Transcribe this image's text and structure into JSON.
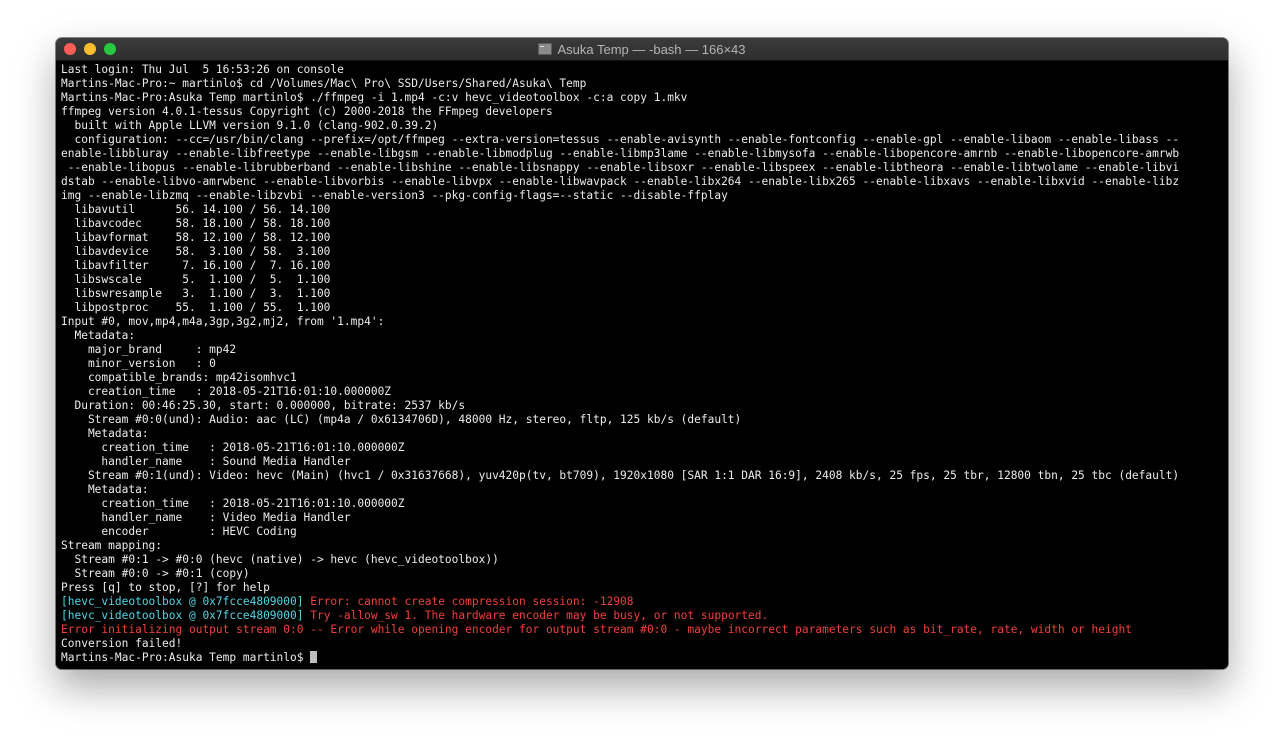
{
  "window": {
    "title": "Asuka Temp — -bash — 166×43"
  },
  "terminal": {
    "lines": [
      "Last login: Thu Jul  5 16:53:26 on console",
      "Martins-Mac-Pro:~ martinlo$ cd /Volumes/Mac\\ Pro\\ SSD/Users/Shared/Asuka\\ Temp",
      "Martins-Mac-Pro:Asuka Temp martinlo$ ./ffmpeg -i 1.mp4 -c:v hevc_videotoolbox -c:a copy 1.mkv",
      "ffmpeg version 4.0.1-tessus Copyright (c) 2000-2018 the FFmpeg developers",
      "  built with Apple LLVM version 9.1.0 (clang-902.0.39.2)",
      "  configuration: --cc=/usr/bin/clang --prefix=/opt/ffmpeg --extra-version=tessus --enable-avisynth --enable-fontconfig --enable-gpl --enable-libaom --enable-libass --",
      "enable-libbluray --enable-libfreetype --enable-libgsm --enable-libmodplug --enable-libmp3lame --enable-libmysofa --enable-libopencore-amrnb --enable-libopencore-amrwb",
      " --enable-libopus --enable-librubberband --enable-libshine --enable-libsnappy --enable-libsoxr --enable-libspeex --enable-libtheora --enable-libtwolame --enable-libvi",
      "dstab --enable-libvo-amrwbenc --enable-libvorbis --enable-libvpx --enable-libwavpack --enable-libx264 --enable-libx265 --enable-libxavs --enable-libxvid --enable-libz",
      "img --enable-libzmq --enable-libzvbi --enable-version3 --pkg-config-flags=--static --disable-ffplay",
      "  libavutil      56. 14.100 / 56. 14.100",
      "  libavcodec     58. 18.100 / 58. 18.100",
      "  libavformat    58. 12.100 / 58. 12.100",
      "  libavdevice    58.  3.100 / 58.  3.100",
      "  libavfilter     7. 16.100 /  7. 16.100",
      "  libswscale      5.  1.100 /  5.  1.100",
      "  libswresample   3.  1.100 /  3.  1.100",
      "  libpostproc    55.  1.100 / 55.  1.100",
      "Input #0, mov,mp4,m4a,3gp,3g2,mj2, from '1.mp4':",
      "  Metadata:",
      "    major_brand     : mp42",
      "    minor_version   : 0",
      "    compatible_brands: mp42isomhvc1",
      "    creation_time   : 2018-05-21T16:01:10.000000Z",
      "  Duration: 00:46:25.30, start: 0.000000, bitrate: 2537 kb/s",
      "    Stream #0:0(und): Audio: aac (LC) (mp4a / 0x6134706D), 48000 Hz, stereo, fltp, 125 kb/s (default)",
      "    Metadata:",
      "      creation_time   : 2018-05-21T16:01:10.000000Z",
      "      handler_name    : Sound Media Handler",
      "    Stream #0:1(und): Video: hevc (Main) (hvc1 / 0x31637668), yuv420p(tv, bt709), 1920x1080 [SAR 1:1 DAR 16:9], 2408 kb/s, 25 fps, 25 tbr, 12800 tbn, 25 tbc (default)",
      "    Metadata:",
      "      creation_time   : 2018-05-21T16:01:10.000000Z",
      "      handler_name    : Video Media Handler",
      "      encoder         : HEVC Coding",
      "Stream mapping:",
      "  Stream #0:1 -> #0:0 (hevc (native) -> hevc (hevc_videotoolbox))",
      "  Stream #0:0 -> #0:1 (copy)",
      "Press [q] to stop, [?] for help"
    ],
    "error_lines": [
      {
        "prefix": "[hevc_videotoolbox @ 0x7fcce4809000] ",
        "message": "Error: cannot create compression session: -12908"
      },
      {
        "prefix": "[hevc_videotoolbox @ 0x7fcce4809000] ",
        "message": "Try -allow_sw 1. The hardware encoder may be busy, or not supported."
      }
    ],
    "error_init_line": "Error initializing output stream 0:0 -- Error while opening encoder for output stream #0:0 - maybe incorrect parameters such as bit_rate, rate, width or height",
    "conversion_failed": "Conversion failed!",
    "prompt": "Martins-Mac-Pro:Asuka Temp martinlo$ "
  },
  "colors": {
    "background": "#000000",
    "text": "#ececec",
    "cyan": "#4fd6e6",
    "red": "#f0413a"
  }
}
